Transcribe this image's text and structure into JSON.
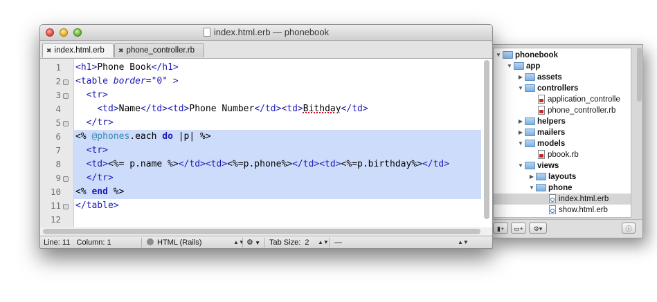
{
  "window": {
    "title": "index.html.erb — phonebook"
  },
  "tabs": [
    {
      "label": "index.html.erb",
      "close": "✖"
    },
    {
      "label": "phone_controller.rb",
      "close": "✖"
    }
  ],
  "editor": {
    "lines": [
      {
        "num": "1"
      },
      {
        "num": "2"
      },
      {
        "num": "3"
      },
      {
        "num": "4"
      },
      {
        "num": "5"
      },
      {
        "num": "6"
      },
      {
        "num": "7"
      },
      {
        "num": "8"
      },
      {
        "num": "9"
      },
      {
        "num": "10"
      },
      {
        "num": "11"
      },
      {
        "num": "12"
      }
    ],
    "code": {
      "l1": {
        "open": "<h1>",
        "text": "Phone Book",
        "close": "</h1>"
      },
      "l2": {
        "open": "<table ",
        "attr": "border",
        "eq": "=",
        "val": "\"0\"",
        "end": " >"
      },
      "l3": {
        "tag": "<tr>"
      },
      "l4": {
        "td1": "<td>",
        "name": "Name",
        "td2": "</td><td>",
        "phone": "Phone Number",
        "td3": "</td><td>",
        "bday": "Bithday",
        "td4": "</td>"
      },
      "l6": {
        "erb_open": "<% ",
        "ivar": "@phones",
        "each": ".each ",
        "do": "do",
        "pipe": " |p| ",
        "erb_close": "%>"
      },
      "l7": {
        "tag": "<tr>"
      },
      "l8": {
        "td1": "<td>",
        "e1": "<%= p.name %>",
        "td2": "</td><td>",
        "e2": "<%=p.phone%>",
        "td3": "</td><td>",
        "e3": "<%=p.birthday%>",
        "td4": "</td>"
      },
      "l9": {
        "tag": "</tr>"
      },
      "l10": {
        "erb_open": "<% ",
        "kw": "end",
        "erb_close": " %>"
      },
      "l11": {
        "tag": "</table>"
      },
      "l5": {
        "tag": "</tr>"
      }
    }
  },
  "status": {
    "line_label": "Line:",
    "line": "11",
    "column_label": "Column:",
    "column": "1",
    "language": "HTML (Rails)",
    "tab_size_label": "Tab Size:",
    "tab_size": "2",
    "symbol": "—"
  },
  "project": {
    "items": [
      {
        "label": "phonebook"
      },
      {
        "label": "app"
      },
      {
        "label": "assets"
      },
      {
        "label": "controllers"
      },
      {
        "label": "application_controlle"
      },
      {
        "label": "phone_controller.rb"
      },
      {
        "label": "helpers"
      },
      {
        "label": "mailers"
      },
      {
        "label": "models"
      },
      {
        "label": "pbook.rb"
      },
      {
        "label": "views"
      },
      {
        "label": "layouts"
      },
      {
        "label": "phone"
      },
      {
        "label": "index.html.erb"
      },
      {
        "label": "show.html.erb"
      }
    ]
  },
  "colors": {
    "selection": "#cddcfb",
    "tag": "#1b1ab8",
    "ivar": "#3b86b0"
  }
}
